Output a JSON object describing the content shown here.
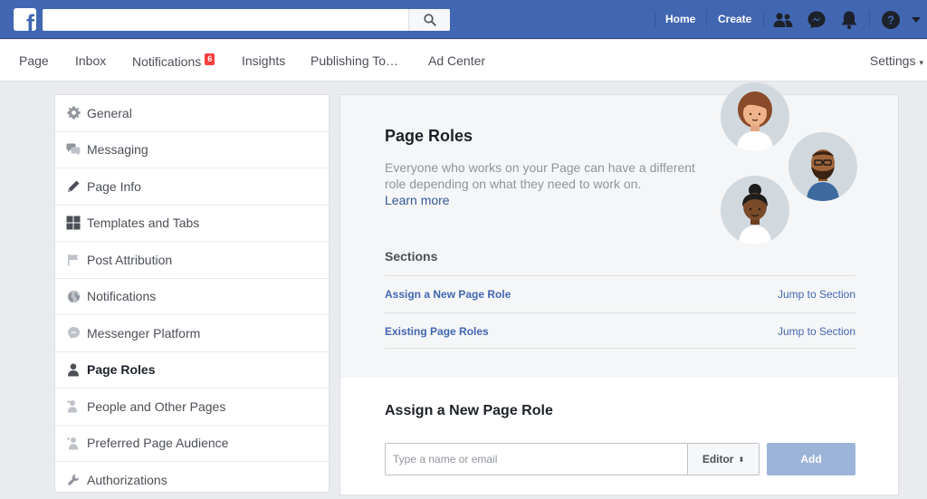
{
  "topbar": {
    "logo_letter": "f",
    "search_placeholder": "",
    "links": {
      "home": "Home",
      "create": "Create"
    },
    "icons": [
      "friends-icon",
      "messenger-icon",
      "notifications-bell-icon",
      "help-icon",
      "account-caret-icon"
    ]
  },
  "pagenav": {
    "tabs": [
      {
        "label": "Page"
      },
      {
        "label": "Inbox"
      },
      {
        "label": "Notifications",
        "badge": "6"
      },
      {
        "label": "Insights"
      },
      {
        "label": "Publishing To…"
      },
      {
        "label": "Ad Center"
      }
    ],
    "settings_label": "Settings"
  },
  "sidebar": {
    "items": [
      {
        "label": "General",
        "icon": "gear-icon"
      },
      {
        "label": "Messaging",
        "icon": "chat-bubbles-icon"
      },
      {
        "label": "Page Info",
        "icon": "pencil-icon"
      },
      {
        "label": "Templates and Tabs",
        "icon": "grid-icon"
      },
      {
        "label": "Post Attribution",
        "icon": "flag-icon"
      },
      {
        "label": "Notifications",
        "icon": "globe-icon"
      },
      {
        "label": "Messenger Platform",
        "icon": "messenger-icon"
      },
      {
        "label": "Page Roles",
        "icon": "person-icon",
        "active": true
      },
      {
        "label": "People and Other Pages",
        "icon": "people-add-icon"
      },
      {
        "label": "Preferred Page Audience",
        "icon": "audience-icon"
      },
      {
        "label": "Authorizations",
        "icon": "wrench-icon"
      }
    ]
  },
  "roles": {
    "title": "Page Roles",
    "description": "Everyone who works on your Page can have a different role depending on what they need to work on.",
    "learn_more": "Learn more",
    "sections_heading": "Sections",
    "sections": [
      {
        "name": "Assign a New Page Role",
        "jump": "Jump to Section"
      },
      {
        "name": "Existing Page Roles",
        "jump": "Jump to Section"
      }
    ]
  },
  "assign": {
    "title": "Assign a New Page Role",
    "input_placeholder": "Type a name or email",
    "role_value": "Editor",
    "add_label": "Add"
  },
  "colors": {
    "brand_blue": "#4267b2",
    "link_blue": "#365899",
    "badge_red": "#fa3e3e",
    "add_button_disabled": "#9cb4d8"
  }
}
